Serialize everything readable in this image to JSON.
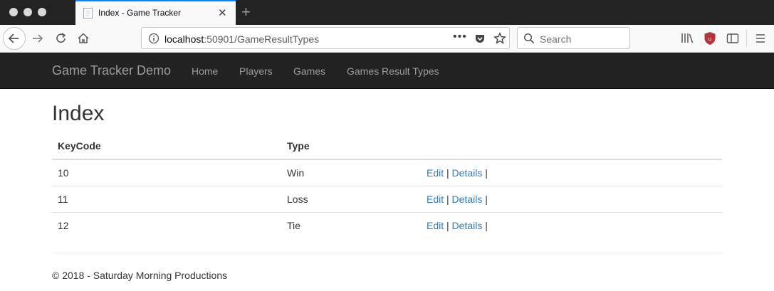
{
  "browser": {
    "tab": {
      "title": "Index - Game Tracker"
    },
    "url": {
      "host": "localhost",
      "path": ":50901/GameResultTypes"
    },
    "search": {
      "placeholder": "Search"
    },
    "icons": [
      "back-icon",
      "forward-icon",
      "reload-icon",
      "home-icon",
      "info-icon",
      "more-icon",
      "pocket-icon",
      "bookmark-star-icon",
      "search-icon",
      "library-icon",
      "ublock-icon",
      "sidebar-icon",
      "menu-icon"
    ]
  },
  "site": {
    "brand": "Game Tracker Demo",
    "nav": [
      "Home",
      "Players",
      "Games",
      "Games Result Types"
    ]
  },
  "page": {
    "title": "Index",
    "table": {
      "headers": [
        "KeyCode",
        "Type"
      ],
      "rows": [
        {
          "keycode": "10",
          "type": "Win",
          "edit": "Edit",
          "details": "Details"
        },
        {
          "keycode": "11",
          "type": "Loss",
          "edit": "Edit",
          "details": "Details"
        },
        {
          "keycode": "12",
          "type": "Tie",
          "edit": "Edit",
          "details": "Details"
        }
      ],
      "separator": "|"
    }
  },
  "footer": {
    "text": "© 2018 - Saturday Morning Productions"
  },
  "colors": {
    "navbar": "#222222",
    "link": "#337ab7",
    "tab_accent": "#0a84ff"
  }
}
